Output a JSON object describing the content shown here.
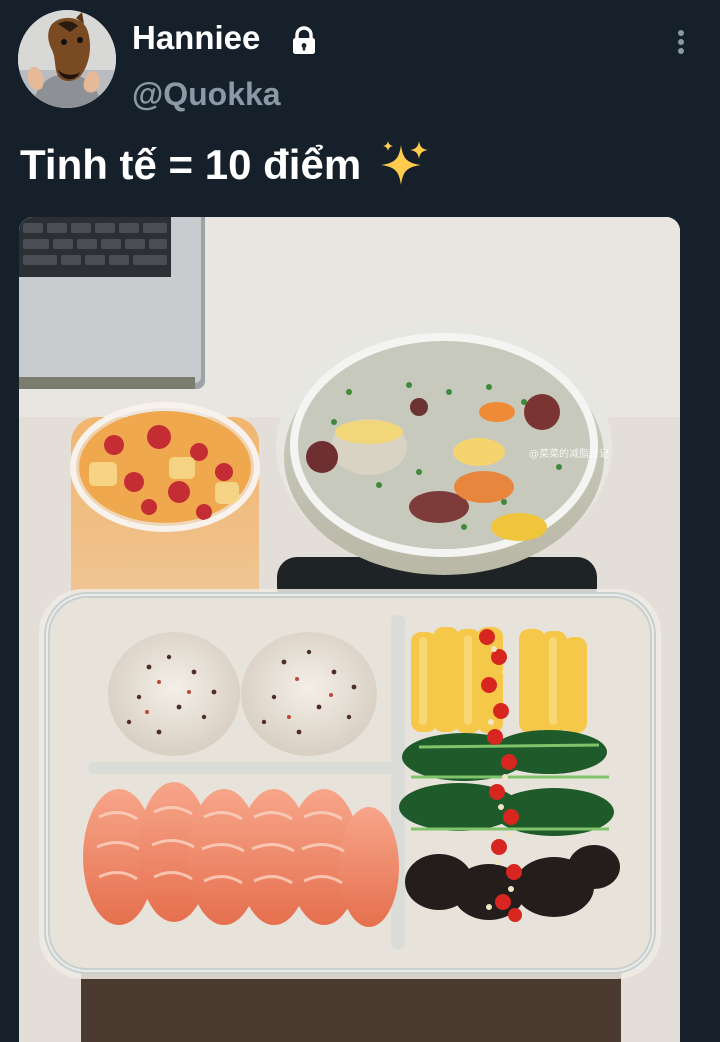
{
  "tweet": {
    "author": {
      "display_name": "Hanniee",
      "handle": "@Quokka",
      "protected_icon": "lock-icon"
    },
    "text": "Tinh tế = 10 điểm",
    "emoji_icon": "sparkles-icon",
    "menu_icon": "more-vertical-icon",
    "media": {
      "type": "photo",
      "watermark": "@菜菜的减脂日记"
    }
  },
  "colors": {
    "background": "#15202b",
    "primary_text": "#ffffff",
    "secondary_text": "#8b98a5"
  }
}
